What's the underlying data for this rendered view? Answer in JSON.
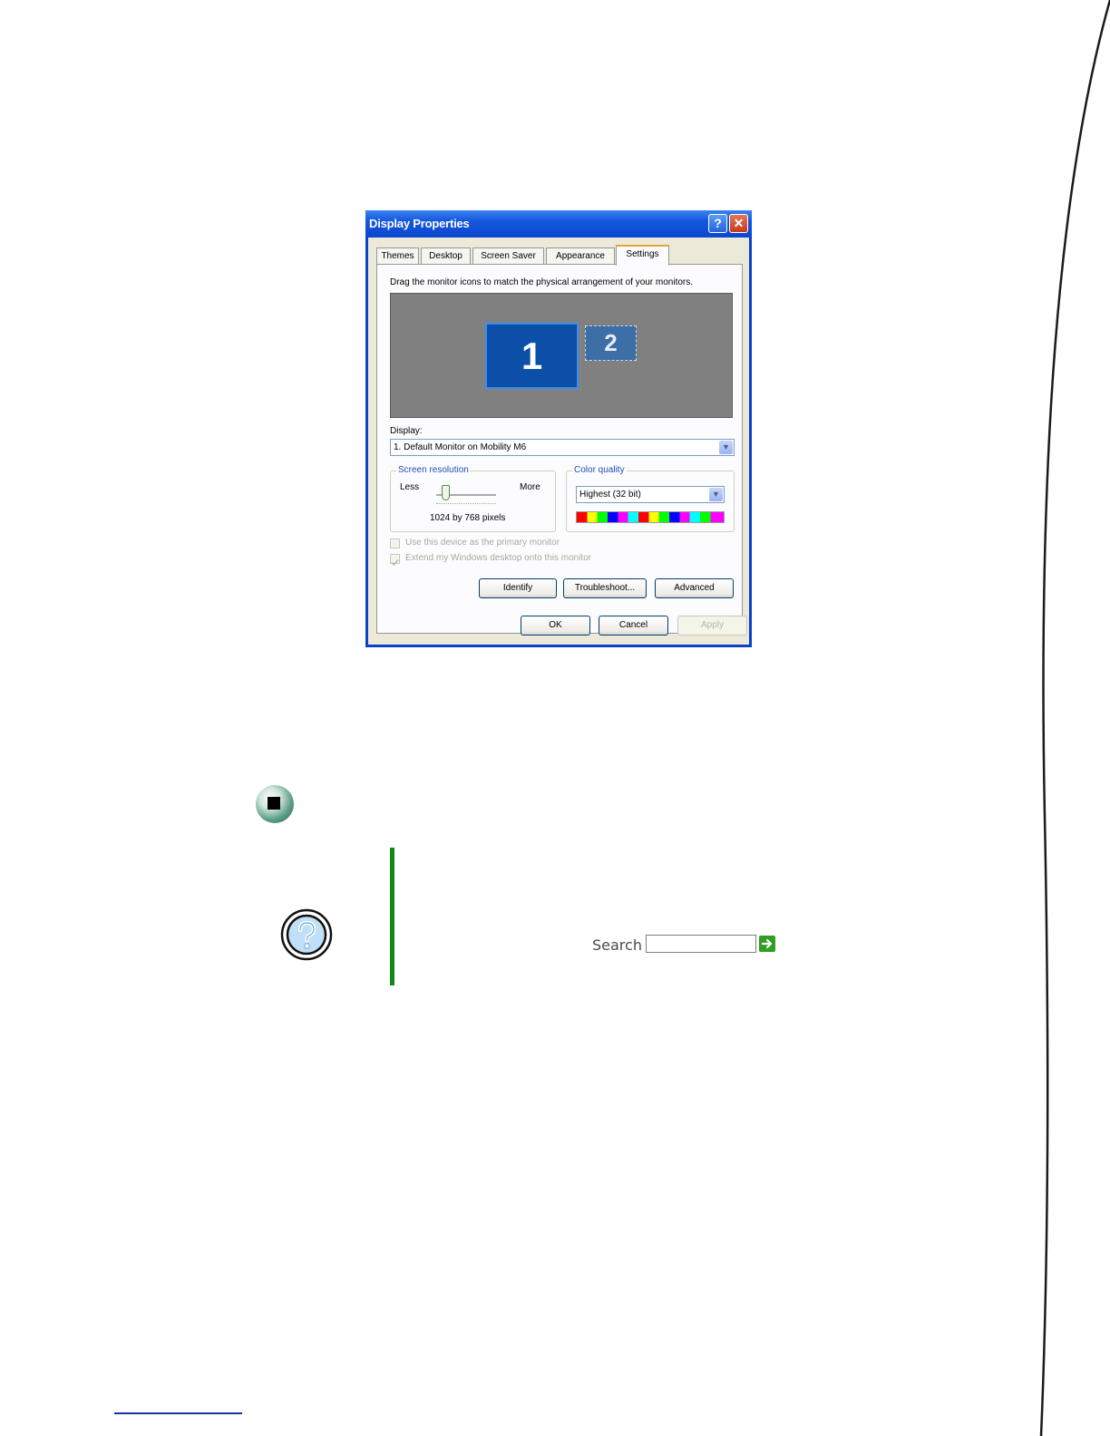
{
  "dialog": {
    "title": "Display Properties",
    "help_glyph": "?",
    "close_glyph": "✕",
    "tabs": [
      {
        "label": "Themes"
      },
      {
        "label": "Desktop"
      },
      {
        "label": "Screen Saver"
      },
      {
        "label": "Appearance"
      },
      {
        "label": "Settings",
        "active": true
      }
    ],
    "instruction": "Drag the monitor icons to match the physical arrangement of your monitors.",
    "monitors": [
      "1",
      "2"
    ],
    "display_label": "Display:",
    "display_value": "1. Default Monitor on Mobility M6",
    "resolution": {
      "legend": "Screen resolution",
      "less": "Less",
      "more": "More",
      "value_text": "1024 by 768 pixels",
      "slider_position": 0.15
    },
    "color_quality": {
      "legend": "Color quality",
      "value": "Highest (32 bit)"
    },
    "checkboxes": [
      {
        "label": "Use this device as the primary monitor",
        "checked": false,
        "enabled": false
      },
      {
        "label": "Extend my Windows desktop onto this monitor",
        "checked": true,
        "enabled": false
      }
    ],
    "buttons": {
      "identify": "Identify",
      "troubleshoot": "Troubleshoot...",
      "advanced": "Advanced",
      "ok": "OK",
      "cancel": "Cancel",
      "apply": "Apply"
    },
    "dropdown_glyph": "▼"
  },
  "search": {
    "label": "Search",
    "value": ""
  },
  "colors": {
    "accent_green": "#0f8a16",
    "xp_blue": "#0842c8",
    "link_blue": "#1a2fa8"
  },
  "icons": [
    "stop-icon",
    "help-icon",
    "search-go-arrow-icon"
  ]
}
